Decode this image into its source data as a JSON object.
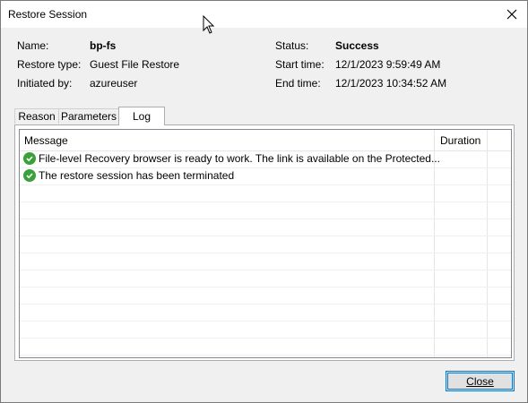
{
  "window": {
    "title": "Restore Session"
  },
  "info": {
    "name_label": "Name:",
    "name_value": "bp-fs",
    "restore_type_label": "Restore type:",
    "restore_type_value": "Guest File Restore",
    "initiated_by_label": "Initiated by:",
    "initiated_by_value": "azureuser",
    "status_label": "Status:",
    "status_value": "Success",
    "start_time_label": "Start time:",
    "start_time_value": "12/1/2023 9:59:49 AM",
    "end_time_label": "End time:",
    "end_time_value": "12/1/2023 10:34:52 AM"
  },
  "tabs": [
    {
      "label": "Reason",
      "active": false
    },
    {
      "label": "Parameters",
      "active": false
    },
    {
      "label": "Log",
      "active": true
    }
  ],
  "log": {
    "columns": [
      "Message",
      "Duration"
    ],
    "rows": [
      {
        "icon": "success-check-icon",
        "message": "File-level Recovery browser is ready to work. The link is available on the Protected...",
        "duration": ""
      },
      {
        "icon": "success-check-icon",
        "message": "The restore session has been terminated",
        "duration": ""
      }
    ]
  },
  "buttons": {
    "close_label": "Close"
  },
  "colors": {
    "success_icon": "#3aa03a",
    "focus_border": "#0078d7"
  }
}
